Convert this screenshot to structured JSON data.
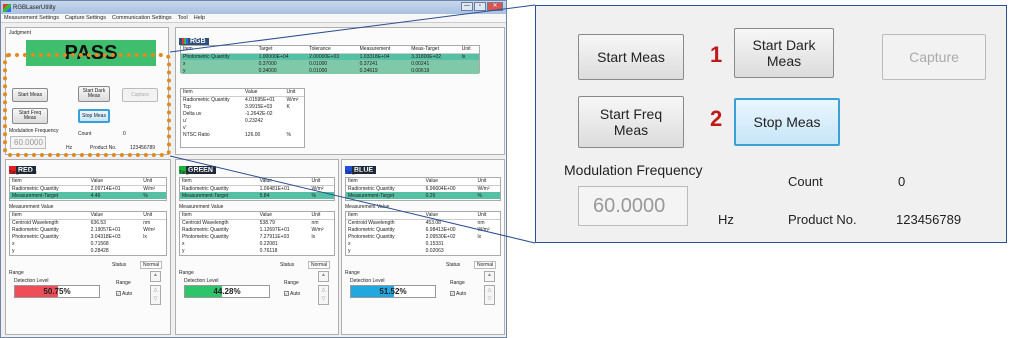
{
  "window": {
    "title": "RGBLaserUtility",
    "min": "—",
    "max": "▫",
    "close": "✕"
  },
  "menu": [
    "Measurement Settings",
    "Capture Settings",
    "Communication Settings",
    "Tool",
    "Help"
  ],
  "judgment": {
    "label": "Judgment",
    "result": "PASS"
  },
  "controls": {
    "start_meas": "Start Meas",
    "start_dark": "Start Dark Meas",
    "capture": "Capture",
    "start_freq": "Start Freq Meas",
    "stop_meas": "Stop Meas",
    "mod_freq_label": "Modulation Frequency",
    "mod_freq_value": "60.0000",
    "hz": "Hz",
    "count_label": "Count",
    "count_value": "0",
    "product_label": "Product No.",
    "product_value": "123456789"
  },
  "rgb": {
    "title": "RGB",
    "target_headers": [
      "Item",
      "Target",
      "Tolerance",
      "Measurement",
      "Meas-Target",
      "Unit"
    ],
    "target_rows": [
      [
        "Photometric Quantity",
        "1.00000E+04",
        "2.00000E+03",
        "1.03318E+04",
        "3.31800E+02",
        "lx"
      ],
      [
        "x",
        "0.37000",
        "0.01000",
        "0.37241",
        "0.00241",
        ""
      ],
      [
        "y",
        "0.34000",
        "0.01000",
        "0.34619",
        "0.00619",
        ""
      ]
    ],
    "meas_headers": [
      "Item",
      "Value",
      "Unit"
    ],
    "meas_rows": [
      [
        "Radiometric Quantity",
        "4.01595E+01",
        "W/m²"
      ],
      [
        "Tcp",
        "3.9915E+03",
        "K"
      ],
      [
        "Delta uv",
        "-1.2642E-02",
        ""
      ],
      [
        "u'",
        "0.23242",
        ""
      ],
      [
        "v'",
        "",
        ""
      ],
      [
        "NTSC Ratio",
        "126.00",
        "%"
      ]
    ]
  },
  "channels": [
    {
      "name": "RED",
      "swatch": "#e02020",
      "target_label": "Target Value",
      "target_rows": [
        [
          "Item",
          "Value",
          "Unit"
        ],
        [
          "Radiometric Quantity",
          "2.09714E+01",
          "W/m²"
        ],
        [
          "Measurement-Target",
          "4.46",
          "%"
        ]
      ],
      "meas_label": "Measurement Value",
      "meas_rows": [
        [
          "Item",
          "Value",
          "Unit"
        ],
        [
          "Centroid Wavelength",
          "636.53",
          "nm"
        ],
        [
          "Radiometric Quantity",
          "2.19057E+01",
          "W/m²"
        ],
        [
          "Photometric Quantity",
          "3.04318E+03",
          "lx"
        ],
        [
          "x",
          "0.71568",
          ""
        ],
        [
          "y",
          "0.28428",
          ""
        ]
      ],
      "status_label": "Status",
      "status_value": "Normal",
      "range_label": "Range",
      "detection_label": "Detection Level",
      "range_sel": "Range",
      "level_text": "50.75%",
      "level": 0.5075,
      "level_color": "#ef4d57",
      "auto": "Auto"
    },
    {
      "name": "GREEN",
      "swatch": "#20b040",
      "target_label": "Target Value",
      "target_rows": [
        [
          "Item",
          "Value",
          "Unit"
        ],
        [
          "Radiometric Quantity",
          "1.06481E+01",
          "W/m²"
        ],
        [
          "Measurement-Target",
          "5.84",
          "%"
        ]
      ],
      "meas_label": "Measurement Value",
      "meas_rows": [
        [
          "Item",
          "Value",
          "Unit"
        ],
        [
          "Centroid Wavelength",
          "538.79",
          "nm"
        ],
        [
          "Radiometric Quantity",
          "1.12697E+01",
          "W/m²"
        ],
        [
          "Photometric Quantity",
          "7.27911E+03",
          "lx"
        ],
        [
          "x",
          "0.22081",
          ""
        ],
        [
          "y",
          "0.76118",
          ""
        ]
      ],
      "status_label": "Status",
      "status_value": "Normal",
      "range_label": "Range",
      "detection_label": "Detection Level",
      "range_sel": "Range",
      "level_text": "44.28%",
      "level": 0.4428,
      "level_color": "#2ec46a",
      "auto": "Auto"
    },
    {
      "name": "BLUE",
      "swatch": "#2050e0",
      "target_label": "Target Value",
      "target_rows": [
        [
          "Item",
          "Value",
          "Unit"
        ],
        [
          "Radiometric Quantity",
          "6.96604E+00",
          "W/m²"
        ],
        [
          "Measurement-Target",
          "0.26",
          "%"
        ]
      ],
      "meas_label": "Measurement Value",
      "meas_rows": [
        [
          "Item",
          "Value",
          "Unit"
        ],
        [
          "Centroid Wavelength",
          "453.08",
          "nm"
        ],
        [
          "Radiometric Quantity",
          "6.98413E+00",
          "W/m²"
        ],
        [
          "Photometric Quantity",
          "2.09530E+02",
          "lx"
        ],
        [
          "x",
          "0.15331",
          ""
        ],
        [
          "y",
          "0.02063",
          ""
        ]
      ],
      "status_label": "Status",
      "status_value": "Normal",
      "range_label": "Range",
      "detection_label": "Detection Level",
      "range_sel": "Range",
      "level_text": "51.52%",
      "level": 0.5152,
      "level_color": "#22a8e0",
      "auto": "Auto"
    }
  ],
  "callouts": {
    "one": "1",
    "two": "2"
  },
  "colors": {
    "accent": "#3aa0d8",
    "pass_bg": "#3fbf6e",
    "highlight": "#55c0a4",
    "callout": "#c0191a",
    "dots": "#e08a20"
  }
}
